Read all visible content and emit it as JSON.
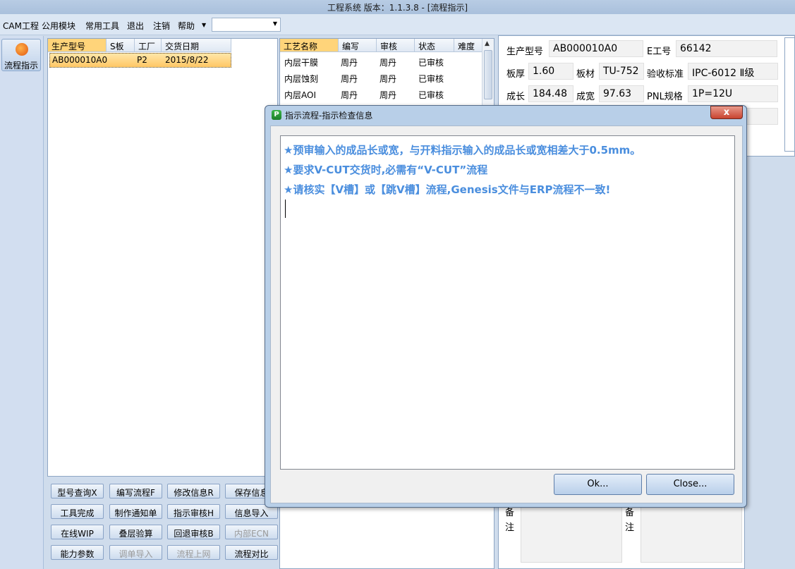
{
  "window": {
    "title": "工程系统   版本：1.1.3.8 - [流程指示]"
  },
  "menu": {
    "items": [
      "CAM工程",
      "公用模块",
      "常用工具",
      "退出",
      "注销",
      "帮助"
    ],
    "combo_value": ""
  },
  "sidebar": {
    "button_label": "流程指示"
  },
  "orders_table": {
    "headers": [
      "生产型号",
      "S板",
      "工厂",
      "交货日期"
    ],
    "rows": [
      {
        "model": "AB000010A0",
        "s": "",
        "factory": "P2",
        "date": "2015/8/22"
      }
    ]
  },
  "process_table": {
    "headers": [
      "工艺名称",
      "编写",
      "审核",
      "状态",
      "难度"
    ],
    "rows": [
      {
        "name": "内层干膜",
        "writer": "周丹",
        "reviewer": "周丹",
        "status": "已审核",
        "diff": ""
      },
      {
        "name": "内层蚀刻",
        "writer": "周丹",
        "reviewer": "周丹",
        "status": "已审核",
        "diff": ""
      },
      {
        "name": "内层AOI",
        "writer": "周丹",
        "reviewer": "周丹",
        "status": "已审核",
        "diff": ""
      }
    ]
  },
  "info": {
    "model_label": "生产型号",
    "model_value": "AB000010A0",
    "engineer_label": "E工号",
    "engineer_value": "66142",
    "thickness_label": "板厚",
    "thickness_value": "1.60",
    "material_label": "板材",
    "material_value": "TU-752",
    "standard_label": "验收标准",
    "standard_value": "IPC-6012 Ⅱ级",
    "length_label": "成长",
    "length_value": "184.48",
    "width_label": "成宽",
    "width_value": "97.63",
    "pnl_label": "PNL规格",
    "pnl_value": "1P=12U"
  },
  "buttons": [
    {
      "label": "型号查询X",
      "enabled": true
    },
    {
      "label": "编写流程F",
      "enabled": true
    },
    {
      "label": "修改信息R",
      "enabled": true
    },
    {
      "label": "保存信息",
      "enabled": true
    },
    {
      "label": "工具完成",
      "enabled": true
    },
    {
      "label": "制作通知单",
      "enabled": true
    },
    {
      "label": "指示审核H",
      "enabled": true
    },
    {
      "label": "信息导入",
      "enabled": true
    },
    {
      "label": "在线WIP",
      "enabled": true
    },
    {
      "label": "叠层验算",
      "enabled": true
    },
    {
      "label": "回退审核B",
      "enabled": true
    },
    {
      "label": "内部ECN",
      "enabled": false
    },
    {
      "label": "能力参数",
      "enabled": true
    },
    {
      "label": "调单导入",
      "enabled": false
    },
    {
      "label": "流程上网",
      "enabled": false
    },
    {
      "label": "流程对比",
      "enabled": true
    }
  ],
  "memo": {
    "label_left": "备注",
    "label_right": "备注"
  },
  "dialog": {
    "title": "指示流程-指示检查信息",
    "close_glyph": "x",
    "messages": [
      "★预审输入的成品长或宽，与开料指示输入的成品长或宽相差大于0.5mm。",
      "★要求V-CUT交货时,必需有“V-CUT”流程",
      "★请核实【V槽】或【跳V槽】流程,Genesis文件与ERP流程不一致!"
    ],
    "ok_label": "Ok...",
    "close_label": "Close..."
  },
  "colors": {
    "message_text": "#4a8ede",
    "selection": "#ffc765",
    "close_button": "#c8432f"
  }
}
